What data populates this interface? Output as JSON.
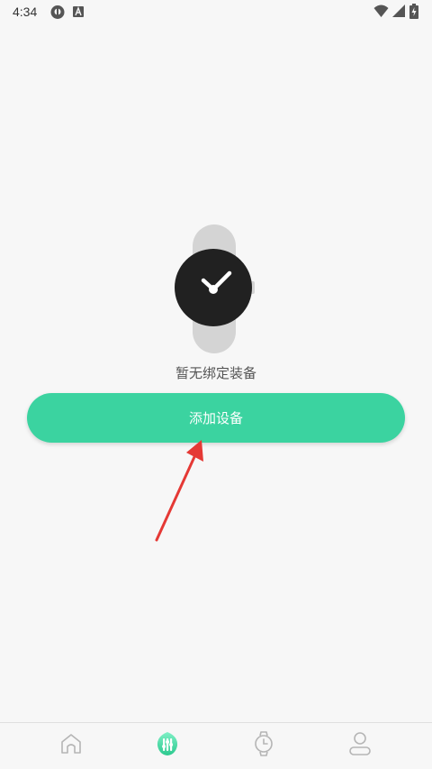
{
  "status_bar": {
    "time": "4:34",
    "icons": [
      "notification-icon",
      "keyboard-a-icon",
      "wifi-icon",
      "signal-icon",
      "battery-charging-icon"
    ]
  },
  "main": {
    "empty_label": "暂无绑定装备",
    "add_button_label": "添加设备",
    "illustration": "watch-icon"
  },
  "bottom_nav": {
    "items": [
      {
        "icon": "home-icon",
        "active": false
      },
      {
        "icon": "health-icon",
        "active": true
      },
      {
        "icon": "device-watch-icon",
        "active": false
      },
      {
        "icon": "profile-icon",
        "active": false
      }
    ]
  },
  "colors": {
    "accent": "#3bd3a0",
    "arrow": "#e53935",
    "background": "#f7f7f7"
  }
}
